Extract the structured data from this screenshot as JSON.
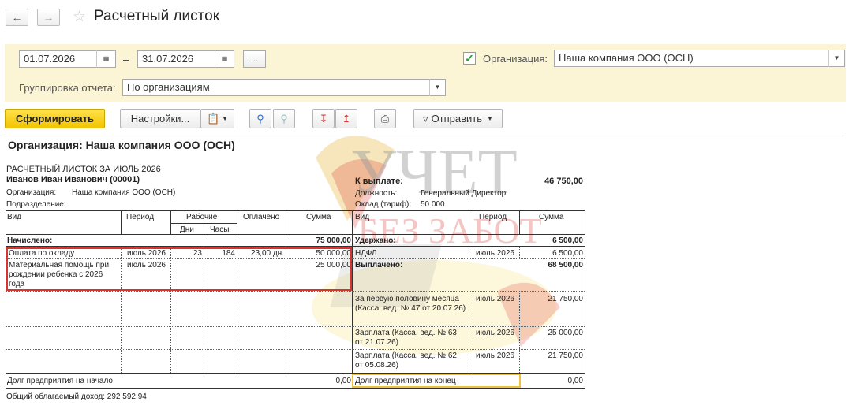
{
  "window": {
    "title": "Расчетный листок"
  },
  "filters": {
    "date_from": "01.07.2026",
    "date_sep": "–",
    "date_to": "31.07.2026",
    "more_label": "...",
    "org_checked": true,
    "org_label": "Организация:",
    "org_value": "Наша компания ООО (ОСН)",
    "grouping_label": "Группировка отчета:",
    "grouping_value": "По организациям"
  },
  "toolbar": {
    "generate": "Сформировать",
    "settings": "Настройки...",
    "send": "Отправить"
  },
  "report": {
    "org_header": "Организация: Наша компания ООО (ОСН)",
    "sheet_title": "РАСЧЕТНЫЙ ЛИСТОК ЗА ИЮЛЬ 2026",
    "employee": "Иванов Иван Иванович (00001)",
    "org_line_label": "Организация:",
    "org_line_value": "Наша компания ООО (ОСН)",
    "division_label": "Подразделение:",
    "pay_label": "К выплате:",
    "pay_value": "46 750,00",
    "position_label": "Должность:",
    "position_value": "Генеральный Директор",
    "salary_label": "Оклад (тариф):",
    "salary_value": "50 000",
    "left_headers": {
      "vid": "Вид",
      "period": "Период",
      "work": "Рабочие",
      "days": "Дни",
      "hours": "Часы",
      "paid": "Оплачено",
      "sum": "Сумма"
    },
    "right_headers": {
      "vid": "Вид",
      "period": "Период",
      "sum": "Сумма"
    },
    "accrued_label": "Начислено:",
    "accrued_total": "75 000,00",
    "withheld_label": "Удержано:",
    "withheld_total": "6 500,00",
    "accruals": [
      {
        "vid": "Оплата по окладу",
        "period": "июль 2026",
        "days": "23",
        "hours": "184",
        "paid": "23,00 дн.",
        "sum": "50 000,00"
      },
      {
        "vid": "Материальная помощь при рождении ребенка с 2026 года",
        "period": "июль 2026",
        "days": "",
        "hours": "",
        "paid": "",
        "sum": "25 000,00"
      }
    ],
    "ndfl": {
      "vid": "НДФЛ",
      "period": "июль 2026",
      "sum": "6 500,00"
    },
    "paid_out_label": "Выплачено:",
    "paid_out_total": "68 500,00",
    "payouts": [
      {
        "vid": "За первую половину месяца (Касса, вед. № 47 от 20.07.26)",
        "period": "июль 2026",
        "sum": "21 750,00"
      },
      {
        "vid": "Зарплата (Касса, вед. № 63 от 21.07.26)",
        "period": "июль 2026",
        "sum": "25 000,00"
      },
      {
        "vid": "Зарплата (Касса, вед. № 62 от 05.08.26)",
        "period": "июль 2026",
        "sum": "21 750,00"
      }
    ],
    "debt_start_label": "Долг предприятия на начало",
    "debt_start_value": "0,00",
    "debt_end_label": "Долг предприятия на конец",
    "debt_end_value": "0,00",
    "taxable_income": "Общий облагаемый доход: 292 592,94"
  },
  "watermark": {
    "line1": "УЧЕТ",
    "line2": "БЕЗ ЗАБОТ"
  },
  "colors": {
    "accent_yellow": "#f5cc00",
    "panel_bg": "#fbf5d6",
    "highlight_red": "#d9342b",
    "highlight_gold": "#f0c040"
  }
}
